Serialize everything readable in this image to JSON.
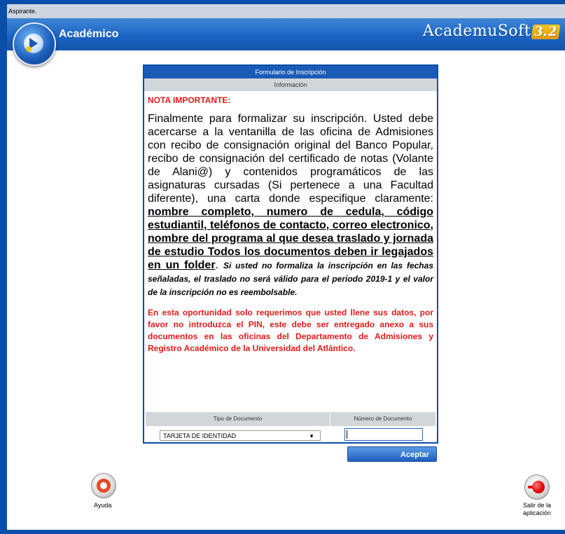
{
  "status_bar": {
    "text": "Aspirante."
  },
  "header": {
    "title": "Académico",
    "brand": "AcademuSoft",
    "brand_version": "3.2"
  },
  "form": {
    "title": "Formulario de Inscripción",
    "subtitle": "Información",
    "nota": "NOTA IMPORTANTE:",
    "paragraph_main": "Finalmente para formalizar su inscripción. Usted debe acercarse a la ventanilla de las oficina de Admisiones con recibo de consignación original del Banco Popular, recibo de consignación del certificado de notas (Volante de Alani@) y contenidos programáticos de las asignaturas cursadas (Si pertenece a una Facultad diferente), una carta donde especifique claramente: ",
    "paragraph_underlined": "nombre completo, numero de cedula, código estudiantil, teléfonos de contacto, correo electronico, nombre del programa al que desea traslado y jornada de estudio Todos los documentos deben ir legajados en un folder",
    "paragraph_period": ". ",
    "paragraph_italic": "Si usted no formaliza la inscripción en las fechas señaladas, el traslado no será válido para el periodo 2019-1 y el valor de la inscripción no es reembolsable.",
    "red_note": "En esta oportunidad solo requerimos que usted llene sus datos, por favor no introduzca el PIN, este debe ser entregado anexo a sus documentos en las oficinas del Departamento de Admisiones y Registro Académico de la Universidad del Atlántico.",
    "doc_type_header": "Tipo de Documento",
    "doc_number_header": "Número de Documento",
    "doc_type_value": "TARJETA DE IDENTIDAD",
    "doc_number_value": "",
    "accept_label": "Aceptar"
  },
  "footer": {
    "help_label": "Ayuda",
    "exit_label": "Salir de la aplicación"
  },
  "icons": {
    "header_logo": "academic-logo-icon",
    "help": "lifebuoy-icon",
    "exit": "exit-icon"
  },
  "colors": {
    "header_blue": "#1b64c2",
    "border_blue": "#0a4ea8",
    "note_red": "#e11a1a",
    "panel_gray": "#d3d6d9"
  }
}
